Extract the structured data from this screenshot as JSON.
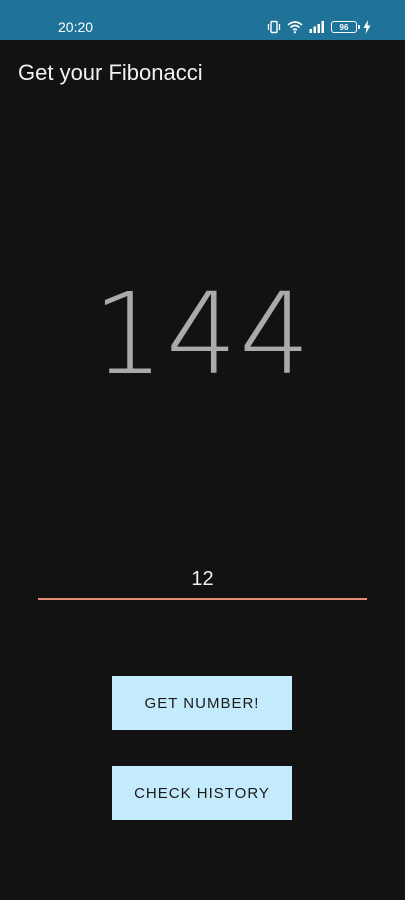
{
  "status_bar": {
    "time": "20:20",
    "battery_level": "96",
    "icons": [
      "vibrate-icon",
      "wifi-icon",
      "signal-icon",
      "battery-icon",
      "charging-icon"
    ],
    "background_color": "#1F7399"
  },
  "app": {
    "title": "Get your Fibonacci"
  },
  "result": {
    "value": "144"
  },
  "input": {
    "value": "12",
    "underline_color": "#E58B74"
  },
  "buttons": {
    "get_number": "GET NUMBER!",
    "check_history": "CHECK HISTORY",
    "color": "#C3EBFC"
  }
}
